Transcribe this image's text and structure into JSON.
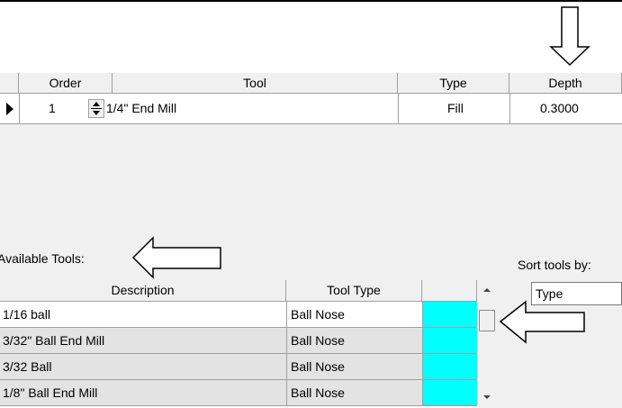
{
  "order_grid": {
    "headers": [
      "Order",
      "Tool",
      "Type",
      "Depth"
    ],
    "rows": [
      {
        "order": "1",
        "tool": "1/4\" End Mill",
        "type": "Fill",
        "depth": "0.3000"
      }
    ]
  },
  "available_tools_label": "Available Tools:",
  "sort_label": "Sort tools by:",
  "sort_value": "Type",
  "tools_list": {
    "headers": [
      "Description",
      "Tool Type",
      ""
    ],
    "rows": [
      {
        "description": "1/16 ball",
        "tool_type": "Ball Nose",
        "color": "#00ffff"
      },
      {
        "description": "3/32\" Ball End Mill",
        "tool_type": "Ball Nose",
        "color": "#00ffff"
      },
      {
        "description": "3/32  Ball",
        "tool_type": "Ball Nose",
        "color": "#00ffff"
      },
      {
        "description": "1/8\" Ball End Mill",
        "tool_type": "Ball Nose",
        "color": "#00ffff"
      }
    ]
  },
  "icons": {
    "row_pointer": "row-pointer-icon",
    "spinner": "spinner-icon",
    "annotation_arrow": "annotation-arrow-icon"
  }
}
